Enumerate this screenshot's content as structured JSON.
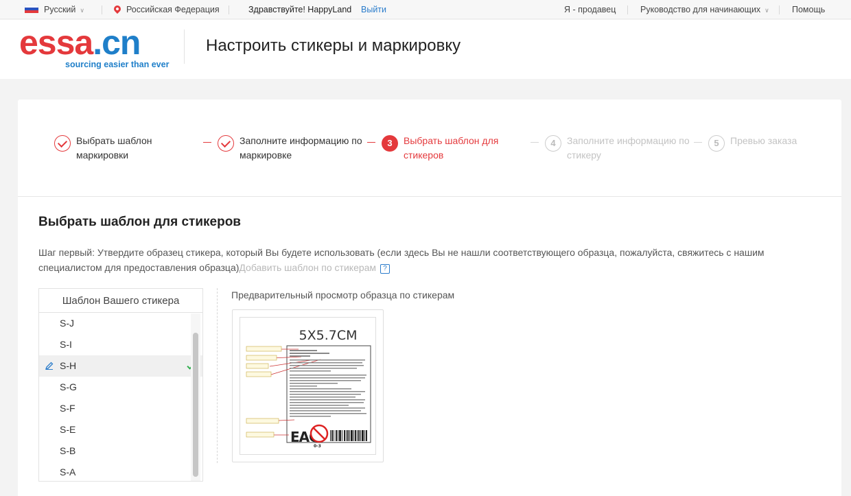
{
  "topbar": {
    "language": "Русский",
    "region": "Российская Федерация",
    "greeting": "Здравствуйте! HappyLand",
    "logout": "Выйти",
    "seller": "Я - продавец",
    "guide": "Руководство для начинающих",
    "help": "Помощь"
  },
  "header": {
    "logo_main": "essa",
    "logo_tld": ".cn",
    "logo_tagline": "sourcing easier than ever",
    "page_title": "Настроить стикеры и маркировку"
  },
  "steps": [
    {
      "num": "1",
      "label": "Выбрать шаблон маркировки",
      "state": "done"
    },
    {
      "num": "2",
      "label": "Заполните информацию по маркировке",
      "state": "done"
    },
    {
      "num": "3",
      "label": "Выбрать шаблон для стикеров",
      "state": "current"
    },
    {
      "num": "4",
      "label": "Заполните информацию по стикеру",
      "state": "todo"
    },
    {
      "num": "5",
      "label": "Превью заказа",
      "state": "todo"
    }
  ],
  "section": {
    "title": "Выбрать шаблон для стикеров",
    "desc": "Шаг первый: Утвердите образец стикера, который Вы будете использовать (если здесь Вы не нашли соответствующего образца, пожалуйста, свяжитесь с нашим специалистом для предоставления образца)",
    "add_link": "Добавить шаблон по стикерам",
    "help_mark": "?"
  },
  "template_list": {
    "header": "Шаблон Вашего стикера",
    "items": [
      "S-J",
      "S-I",
      "S-H",
      "S-G",
      "S-F",
      "S-E",
      "S-B",
      "S-A"
    ],
    "selected": "S-H"
  },
  "preview": {
    "title": "Предварительный просмотр образца по стикерам",
    "sticker_size": "5X5.7CM",
    "sticker_mark": "EAC",
    "sticker_age": "0-3"
  },
  "colors": {
    "accent_red": "#e4393c",
    "brand_blue": "#1f7fc9",
    "check_green": "#2fae4d"
  }
}
